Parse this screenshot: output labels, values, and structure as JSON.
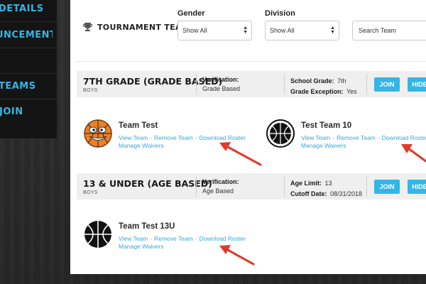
{
  "sidebar": {
    "items": [
      {
        "label": "DETAILS"
      },
      {
        "label": "UNCEMENTS"
      },
      {
        "label": "TEAMS"
      },
      {
        "label": "JOIN"
      }
    ]
  },
  "header": {
    "title": "TOURNAMENT TEAMS",
    "icon": "trophy-icon"
  },
  "filters": {
    "gender": {
      "label": "Gender",
      "value": "Show All"
    },
    "division": {
      "label": "Division",
      "value": "Show All"
    },
    "search": {
      "placeholder": "Search Team"
    }
  },
  "divisions": [
    {
      "name": "7TH GRADE (GRADE BASED)",
      "gender": "BOYS",
      "verification_label": "Verification:",
      "verification_value": "Grade Based",
      "info1_label": "School Grade:",
      "info1_value": "7th",
      "info2_label": "Grade Exception:",
      "info2_value": "Yes",
      "join_label": "JOIN",
      "hide_label": "HIDE",
      "teams": [
        {
          "name": "Team Test",
          "logo": "basketball-mascot-logo",
          "links": [
            "View Team",
            "Remove Team",
            "Download Roster"
          ],
          "waivers": "Manage Waivers"
        },
        {
          "name": "Test Team 10",
          "logo": "basketball-circle-logo",
          "links": [
            "View Team",
            "Remove Team",
            "Download Roster"
          ],
          "waivers": "Manage Waivers"
        }
      ]
    },
    {
      "name": "13 & UNDER (AGE BASED)",
      "gender": "BOYS",
      "verification_label": "Verification:",
      "verification_value": "Age Based",
      "info1_label": "Age Limit:",
      "info1_value": "13",
      "info2_label": "Cutoff Date:",
      "info2_value": "08/31/2018",
      "join_label": "JOIN",
      "hide_label": "HIDE",
      "teams": [
        {
          "name": "Team Test 13U",
          "logo": "basketball-logo",
          "links": [
            "View Team",
            "Remove Team",
            "Download Roster"
          ],
          "waivers": "Manage Waivers"
        }
      ]
    }
  ],
  "colors": {
    "accent": "#33b5e5",
    "annotation_arrow": "#e23a2a",
    "sidebar_bg": "#141414"
  }
}
